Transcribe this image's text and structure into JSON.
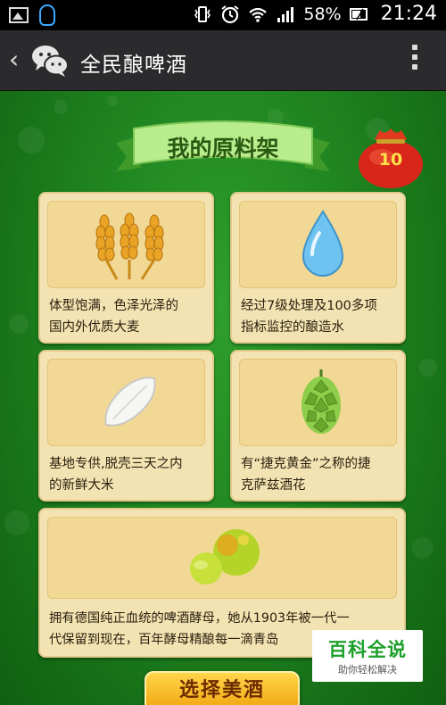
{
  "status_bar": {
    "battery": "58%",
    "time": "21:24",
    "icons": [
      "image-icon",
      "qq-icon",
      "vibrate-icon",
      "alarm-icon",
      "wifi-icon",
      "signal-icon",
      "battery-icon"
    ]
  },
  "action_bar": {
    "back_glyph": "‹",
    "title": "全民酿啤酒",
    "icons": [
      "back-icon",
      "wechat-icon",
      "overflow-menu-icon"
    ]
  },
  "shelf": {
    "title": "我的原料架",
    "bag_count": "10"
  },
  "ingredients": [
    {
      "icon": "wheat-icon",
      "line1": "体型饱满，色泽光泽的",
      "line2": "国内外优质大麦"
    },
    {
      "icon": "water-drop-icon",
      "line1": "经过7级处理及100多项",
      "line2": "指标监控的酿造水"
    },
    {
      "icon": "rice-icon",
      "line1": "基地专供,脱壳三天之内",
      "line2": "的新鲜大米"
    },
    {
      "icon": "hops-icon",
      "line1": "有“捷克黄金”之称的捷",
      "line2": "克萨兹酒花"
    },
    {
      "icon": "yeast-icon",
      "line1": "拥有德国纯正血统的啤酒酵母，她从1903年被一代一",
      "line2": "代保留到现在，百年酵母精酿每一滴青岛"
    }
  ],
  "select_button": {
    "label": "选择美酒"
  },
  "watermark": {
    "main": "百科全说",
    "sub": "助你轻松解决"
  },
  "colors": {
    "background_green": "#1f8420",
    "card": "#f4e3b2",
    "button": "#f2a40f",
    "bag_red": "#d8261a"
  }
}
